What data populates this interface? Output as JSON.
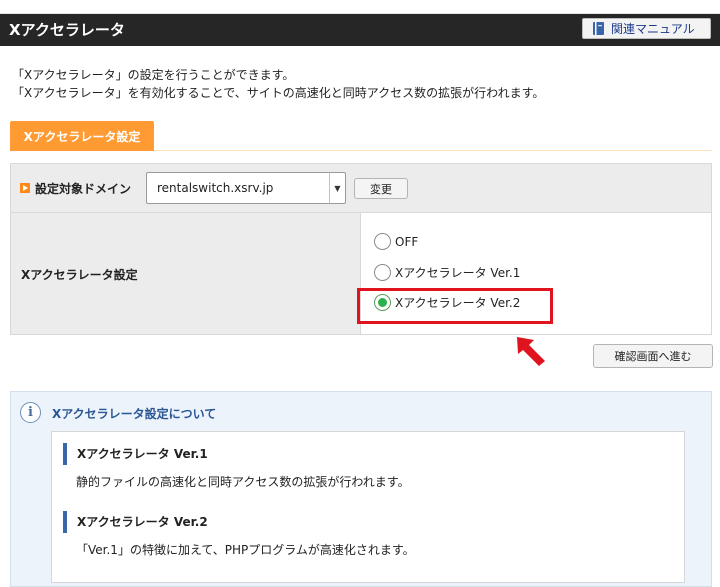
{
  "header": {
    "title": "Xアクセラレータ",
    "manual_button": "関連マニュアル"
  },
  "description": {
    "line1": "「Xアクセラレータ」の設定を行うことができます。",
    "line2": "「Xアクセラレータ」を有効化することで、サイトの高速化と同時アクセス数の拡張が行われます。"
  },
  "tabs": [
    {
      "label": "Xアクセラレータ設定",
      "active": true
    }
  ],
  "domain": {
    "label": "設定対象ドメイン",
    "selected": "rentalswitch.xsrv.jp",
    "change_button": "変更"
  },
  "accelerator": {
    "label": "Xアクセラレータ設定",
    "options": [
      {
        "label": "OFF",
        "checked": false
      },
      {
        "label": "Xアクセラレータ Ver.1",
        "checked": false
      },
      {
        "label": "Xアクセラレータ Ver.2",
        "checked": true
      }
    ]
  },
  "confirm_button": "確認画面へ進む",
  "info": {
    "title": "Xアクセラレータ設定について",
    "items": [
      {
        "heading": "Xアクセラレータ Ver.1",
        "text": "静的ファイルの高速化と同時アクセス数の拡張が行われます。"
      },
      {
        "heading": "Xアクセラレータ Ver.2",
        "text": "「Ver.1」の特徴に加えて、PHPプログラムが高速化されます。"
      }
    ]
  },
  "colors": {
    "header_bg": "#262626",
    "tab_orange": "#ff9b32",
    "highlight_red": "#e0141e",
    "radio_green": "#2bb24c",
    "info_blue": "#2a5794"
  },
  "icons": {
    "manual": "book-icon",
    "domain_bullet": "orange-arrow-icon",
    "info": "info-icon",
    "pointer": "red-arrow-icon"
  }
}
